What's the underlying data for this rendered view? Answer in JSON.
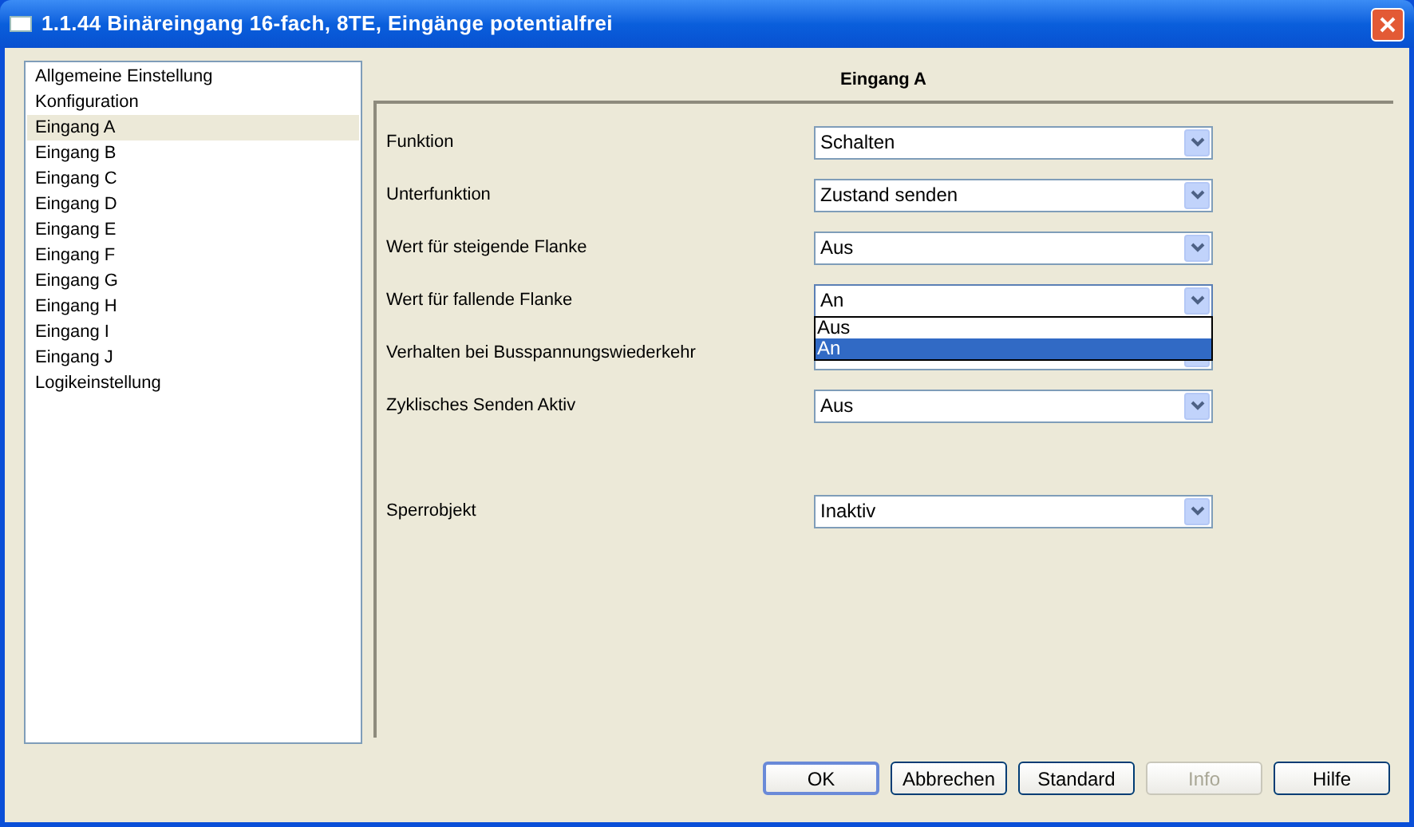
{
  "window": {
    "title": "1.1.44 Binäreingang 16-fach, 8TE, Eingänge potentialfrei"
  },
  "sidebar": {
    "items": [
      {
        "label": "Allgemeine Einstellung",
        "selected": false
      },
      {
        "label": "Konfiguration",
        "selected": false
      },
      {
        "label": "Eingang A",
        "selected": true
      },
      {
        "label": "Eingang B",
        "selected": false
      },
      {
        "label": "Eingang C",
        "selected": false
      },
      {
        "label": "Eingang D",
        "selected": false
      },
      {
        "label": "Eingang E",
        "selected": false
      },
      {
        "label": "Eingang F",
        "selected": false
      },
      {
        "label": "Eingang G",
        "selected": false
      },
      {
        "label": "Eingang H",
        "selected": false
      },
      {
        "label": "Eingang I",
        "selected": false
      },
      {
        "label": "Eingang J",
        "selected": false
      },
      {
        "label": "Logikeinstellung",
        "selected": false
      }
    ]
  },
  "panel": {
    "title": "Eingang A",
    "sections": [
      [
        {
          "label": "Funktion",
          "value": "Schalten",
          "expanded": false
        },
        {
          "label": "Unterfunktion",
          "value": "Zustand senden",
          "expanded": false
        },
        {
          "label": "Wert für steigende Flanke",
          "value": "Aus",
          "expanded": false
        },
        {
          "label": "Wert für fallende Flanke",
          "value": "An",
          "expanded": true,
          "options": [
            {
              "label": "Aus",
              "selected": false
            },
            {
              "label": "An",
              "selected": true
            }
          ]
        },
        {
          "label": "Verhalten bei Busspannungswiederkehr",
          "expanded": false
        },
        {
          "label": "Zyklisches Senden Aktiv",
          "value": "Aus",
          "expanded": false
        }
      ],
      [
        {
          "label": "Sperrobjekt",
          "value": "Inaktiv",
          "expanded": false
        }
      ]
    ]
  },
  "buttons": [
    {
      "label": "OK",
      "disabled": false,
      "default": true
    },
    {
      "label": "Abbrechen",
      "disabled": false,
      "default": false
    },
    {
      "label": "Standard",
      "disabled": false,
      "default": false
    },
    {
      "label": "Info",
      "disabled": true,
      "default": false
    },
    {
      "label": "Hilfe",
      "disabled": false,
      "default": false
    }
  ]
}
